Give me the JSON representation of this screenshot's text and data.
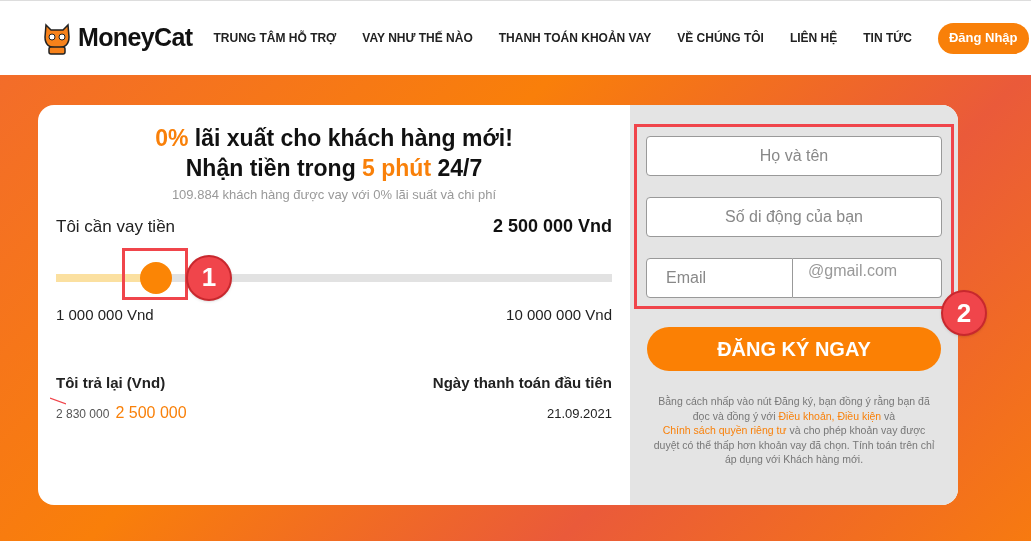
{
  "header": {
    "logo": "MoneyCat",
    "nav": [
      {
        "label": "TRUNG TÂM HỖ TRỢ"
      },
      {
        "label": "VAY NHƯ THẾ NÀO"
      },
      {
        "label": "THANH TOÁN KHOẢN VAY"
      },
      {
        "label": "VỀ CHÚNG TÔI"
      },
      {
        "label": "LIÊN HỆ"
      },
      {
        "label": "TIN TỨC"
      }
    ],
    "login": "Đăng Nhập"
  },
  "calculator": {
    "headline": [
      [
        {
          "text": "0%",
          "highlight": true
        },
        {
          "text": " lãi xuất cho khách hàng mới!",
          "highlight": false
        }
      ],
      [
        {
          "text": "Nhận tiền trong ",
          "highlight": false
        },
        {
          "text": "5 phút",
          "highlight": true
        },
        {
          "text": " 24/7",
          "highlight": false
        }
      ]
    ],
    "subtitle": "109.884 khách hàng được vay với 0% lãi suất và chi phí",
    "amount_label": "Tôi cần vay tiền",
    "amount": "2 500 000 Vnd",
    "slider": {
      "level": 0.18,
      "min_label": "1 000 000 Vnd",
      "max_label": "10 000 000 Vnd",
      "marker": "1"
    },
    "repay_label": "Tôi trả lại (Vnd)",
    "old_price": "2 830 000",
    "new_price": "2 500 000",
    "date_label": "Ngày thanh toán đầu tiên",
    "date": "21.09.2021"
  },
  "form": {
    "marker": "2",
    "name_placeholder": "Họ và tên",
    "phone_placeholder": "Số di động của bạn",
    "email_placeholder": "Email",
    "email_domain": "@gmail.com",
    "submit": "ĐĂNG KÝ NGAY",
    "terms": [
      {
        "kind": "plain",
        "text": "Bằng cách nhấp vào nút Đăng ký, bạn đồng ý rằng bạn đã đọc và đồng ý với "
      },
      {
        "kind": "link",
        "text": "Điều khoản, Điều kiện"
      },
      {
        "kind": "plain",
        "text": " và "
      },
      {
        "kind": "link",
        "text": "Chính sách quyền riêng tư"
      },
      {
        "kind": "plain",
        "text": " và cho phép khoản vay được duyệt có thể thấp hơn khoản vay đã chọn. Tính toán trên chỉ áp dụng với Khách hàng mới."
      }
    ]
  }
}
